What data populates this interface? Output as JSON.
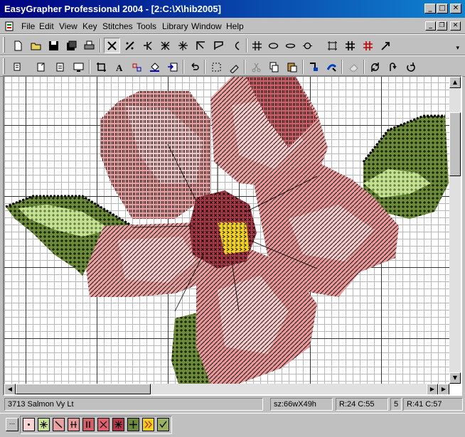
{
  "window": {
    "title": "EasyGrapher Professional 2004 - [2:C:\\X\\hib2005]",
    "minimize": "_",
    "maximize": "□",
    "close": "✕"
  },
  "menu": {
    "items": [
      "File",
      "Edit",
      "View",
      "Key",
      "Stitches",
      "Tools",
      "Library",
      "Window",
      "Help"
    ],
    "mdi": {
      "minimize": "_",
      "restore": "❐",
      "close": "✕"
    }
  },
  "toolbar1": {
    "icons": [
      "new-file",
      "open-folder",
      "save",
      "save-all",
      "print",
      "full-cross-stitch",
      "half-cross",
      "three-quarter-stitch",
      "quarter-stitch",
      "petite-stitch",
      "backstitch-corner",
      "backstitch-flag",
      "arc",
      "grid",
      "oval",
      "oval-small",
      "diamond-dropdown",
      "grid-box",
      "hash-grid",
      "hash-grid-red",
      "arrow-dropdown"
    ]
  },
  "toolbar2": {
    "icons": [
      "select-dropdown",
      "copy-pattern",
      "paste-pattern",
      "monitor",
      "crop",
      "text",
      "replace-color",
      "fill",
      "import",
      "undo",
      "marquee",
      "brush",
      "cut",
      "copy",
      "paste",
      "color-pick",
      "flood",
      "eraser-faded",
      "rotate",
      "flip",
      "redo"
    ]
  },
  "colors": {
    "title_bar": "#000080",
    "petal_light": "#f4c8c8",
    "petal": "#e8a0a0",
    "petal_mid": "#e89898",
    "petal_dark": "#d06068",
    "center": "#b03848",
    "yellow": "#f0d020",
    "leaf_light": "#c8e090",
    "leaf_mid": "#9ab060",
    "leaf_dark": "#6b8a3a",
    "leaf_black": "#202020"
  },
  "status": {
    "thread": "3713  Salmon Vy Lt",
    "size": "sz:66wX49h",
    "rc1": "R:24 C:55",
    "count": "5",
    "rc2": "R:41 C:57"
  },
  "palette": {
    "more": "...",
    "swatches": [
      {
        "name": "salmon-light",
        "bg": "#f8d4d4",
        "mark": "dot"
      },
      {
        "name": "light-green",
        "bg": "#c8e090",
        "mark": "star"
      },
      {
        "name": "pink",
        "bg": "#e8a0a0",
        "mark": "slash"
      },
      {
        "name": "pink-mid",
        "bg": "#e89898",
        "mark": "bars"
      },
      {
        "name": "dark-pink",
        "bg": "#d06068",
        "mark": "dbars"
      },
      {
        "name": "rose",
        "bg": "#e06070",
        "mark": "x"
      },
      {
        "name": "red-dark",
        "bg": "#b03848",
        "mark": "asterisk"
      },
      {
        "name": "green-dark",
        "bg": "#6b8a3a",
        "mark": "plus"
      },
      {
        "name": "yellow",
        "bg": "#f0d020",
        "mark": "chevron"
      },
      {
        "name": "green-light",
        "bg": "#9ab060",
        "mark": "check"
      }
    ]
  }
}
